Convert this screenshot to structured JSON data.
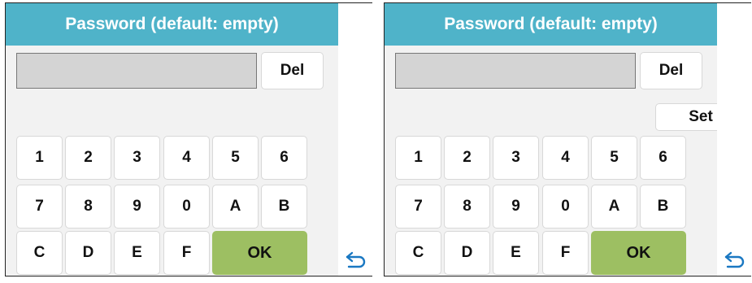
{
  "screens": [
    {
      "title": "Password (default: empty)",
      "password_value": "",
      "del_label": "Del",
      "set_label": null,
      "keys": [
        "1",
        "2",
        "3",
        "4",
        "5",
        "6",
        "7",
        "8",
        "9",
        "0",
        "A",
        "B",
        "C",
        "D",
        "E",
        "F"
      ],
      "ok_label": "OK",
      "back_icon": "back-arrow-icon"
    },
    {
      "title": "Password (default: empty)",
      "password_value": "",
      "del_label": "Del",
      "set_label": "Set",
      "keys": [
        "1",
        "2",
        "3",
        "4",
        "5",
        "6",
        "7",
        "8",
        "9",
        "0",
        "A",
        "B",
        "C",
        "D",
        "E",
        "F"
      ],
      "ok_label": "OK",
      "back_icon": "back-arrow-icon"
    }
  ],
  "colors": {
    "header": "#4fb3c9",
    "ok_button": "#9dbf62",
    "back_icon": "#1a78c2",
    "panel_bg": "#f2f2f2",
    "field_bg": "#d4d4d4"
  }
}
